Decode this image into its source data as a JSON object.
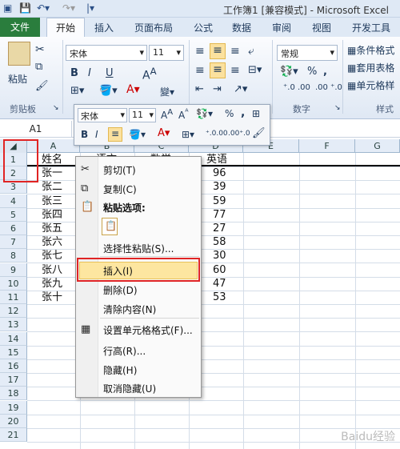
{
  "window": {
    "title": "工作簿1 [兼容模式] - Microsoft Excel"
  },
  "tabs": [
    "文件",
    "开始",
    "插入",
    "页面布局",
    "公式",
    "数据",
    "审阅",
    "视图",
    "开发工具"
  ],
  "ribbon": {
    "paste": "粘贴",
    "clipboard": "剪贴板",
    "font_name": "宋体",
    "font_size": "11",
    "number_format": "常规",
    "number_group": "数字",
    "styles_group": "样式",
    "cond_format": "条件格式",
    "table_format": "套用表格",
    "cell_style": "单元格样"
  },
  "mini_toolbar": {
    "font_name": "宋体",
    "font_size": "11"
  },
  "namebox": "A1",
  "columns": [
    "A",
    "B",
    "C",
    "D",
    "E",
    "F",
    "G"
  ],
  "rows": [
    "1",
    "2",
    "3",
    "4",
    "5",
    "6",
    "7",
    "8",
    "9",
    "10",
    "11",
    "12",
    "13",
    "14",
    "15",
    "16",
    "17",
    "18",
    "19",
    "20",
    "21"
  ],
  "data": {
    "headers": [
      "姓名",
      "语文",
      "数学",
      "英语"
    ],
    "names": [
      "张一",
      "张二",
      "张三",
      "张四",
      "张五",
      "张六",
      "张七",
      "张八",
      "张九",
      "张十"
    ],
    "english": [
      "96",
      "39",
      "59",
      "77",
      "27",
      "58",
      "30",
      "60",
      "47",
      "53"
    ]
  },
  "context_menu": {
    "cut": "剪切(T)",
    "copy": "复制(C)",
    "paste_options": "粘贴选项:",
    "paste_special": "选择性粘贴(S)...",
    "insert": "插入(I)",
    "delete": "删除(D)",
    "clear": "清除内容(N)",
    "format_cells": "设置单元格格式(F)...",
    "row_height": "行高(R)...",
    "hide": "隐藏(H)",
    "unhide": "取消隐藏(U)"
  },
  "watermark": "Baidu经验",
  "colors": {
    "file_tab": "#2a7d3d",
    "highlight": "#e02424",
    "menu_hover": "#fde6a0"
  }
}
